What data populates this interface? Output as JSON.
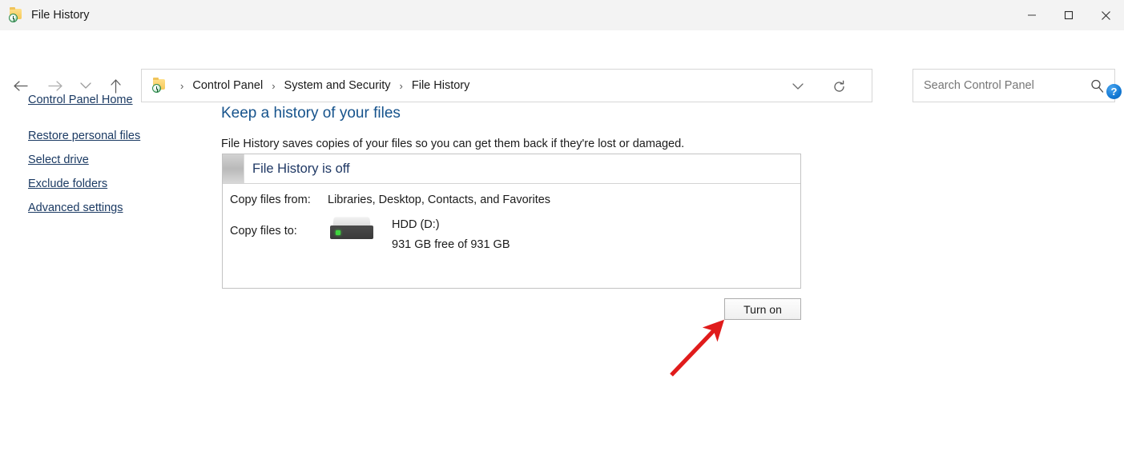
{
  "window": {
    "title": "File History",
    "icon": "folder-clock-icon",
    "controls": {
      "minimize": "minimize-icon",
      "maximize": "maximize-icon",
      "close": "close-icon"
    }
  },
  "navigation": {
    "back": "back-arrow-icon",
    "forward": "forward-arrow-icon",
    "recent": "chevron-down-icon",
    "up": "up-arrow-icon",
    "address_dropdown": "chevron-down-icon",
    "refresh": "refresh-icon"
  },
  "breadcrumb": {
    "icon": "folder-clock-icon",
    "separator": "›",
    "items": [
      "Control Panel",
      "System and Security",
      "File History"
    ]
  },
  "search": {
    "placeholder": "Search Control Panel",
    "value": "",
    "icon": "search-icon"
  },
  "help": {
    "label": "?",
    "icon": "help-icon"
  },
  "sidebar": {
    "home": "Control Panel Home",
    "items": [
      "Restore personal files",
      "Select drive",
      "Exclude folders",
      "Advanced settings"
    ]
  },
  "main": {
    "title": "Keep a history of your files",
    "description": "File History saves copies of your files so you can get them back if they're lost or damaged.",
    "panel": {
      "status": "File History is off",
      "rows": [
        {
          "label": "Copy files from:",
          "value": "Libraries, Desktop, Contacts, and Favorites"
        },
        {
          "label": "Copy files to:",
          "value": ""
        }
      ],
      "drive": {
        "icon": "external-drive-icon",
        "name": "HDD (D:)",
        "capacity": "931 GB free of 931 GB"
      }
    },
    "turn_on_button": "Turn on"
  },
  "annotation": {
    "arrow": "red-arrow-annotation",
    "color": "#e01b1b"
  },
  "colors": {
    "titlebar_bg": "#f3f3f3",
    "link_blue": "#1b3a63",
    "heading_blue": "#16538c",
    "panel_title_blue": "#1f3864",
    "border_gray": "#c3c3c3",
    "accent_red": "#e01b1b"
  }
}
